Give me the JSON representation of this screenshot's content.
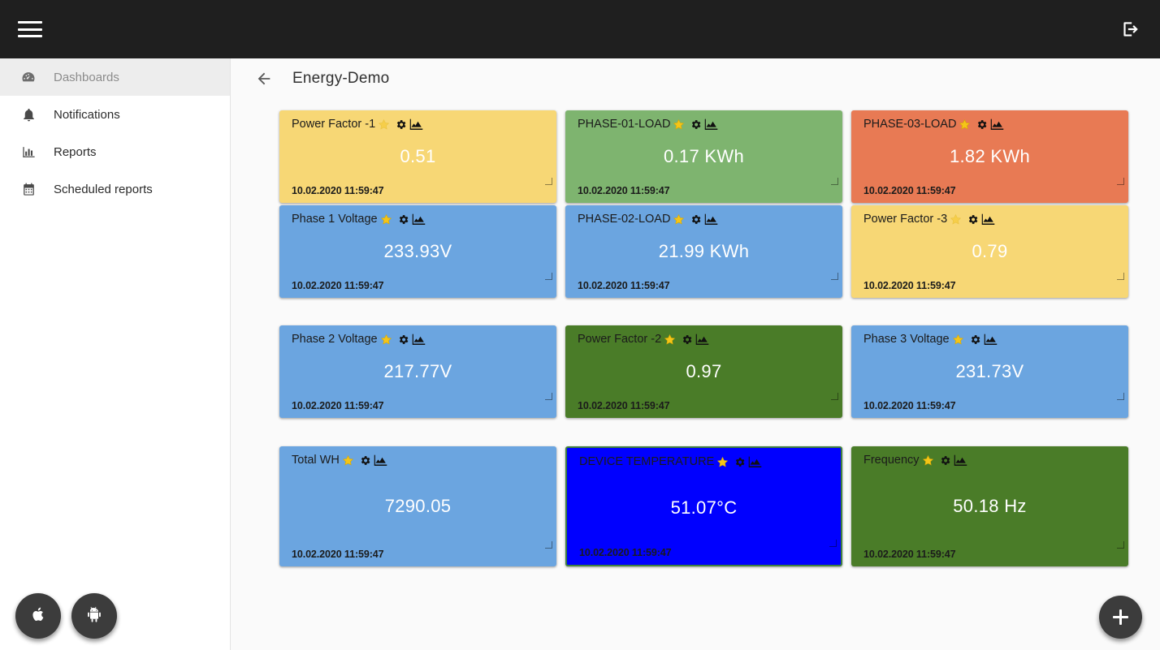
{
  "header": {
    "menu_icon": "hamburger-menu-icon",
    "logout_icon": "logout-icon"
  },
  "sidebar": {
    "items": [
      {
        "label": "Dashboards",
        "icon": "dashboard-gauge-icon",
        "active": true
      },
      {
        "label": "Notifications",
        "icon": "bell-icon",
        "active": false
      },
      {
        "label": "Reports",
        "icon": "bar-chart-icon",
        "active": false
      },
      {
        "label": "Scheduled reports",
        "icon": "calendar-icon",
        "active": false
      }
    ]
  },
  "page": {
    "back_icon": "back-arrow-icon",
    "title": "Energy-Demo"
  },
  "widget_icons": {
    "star": "star-icon",
    "gear": "gear-icon",
    "chart": "area-chart-icon",
    "resize": "resize-handle-icon"
  },
  "colors": {
    "yellow": "#f7d775",
    "light_green": "#7eb46f",
    "orange": "#e87a54",
    "blue": "#6ba5e0",
    "dark_green": "#4a7c28",
    "bright_blue": "#0000ff",
    "selected_border": "#3f7f3f",
    "topbar": "#1f1f1f",
    "fab": "#3c3c3c"
  },
  "cards": [
    {
      "title": "Power Factor -1",
      "value": "0.51",
      "time": "10.02.2020 11:59:47",
      "color": "#f7d775",
      "star_faded": true,
      "height": "short",
      "selected": false
    },
    {
      "title": "PHASE-01-LOAD",
      "value": "0.17 KWh",
      "time": "10.02.2020 11:59:47",
      "color": "#7eb46f",
      "star_faded": false,
      "height": "short",
      "selected": false
    },
    {
      "title": "PHASE-03-LOAD",
      "value": "1.82 KWh",
      "time": "10.02.2020 11:59:47",
      "color": "#e87a54",
      "star_faded": false,
      "height": "short",
      "selected": false
    },
    {
      "title": "Phase 1 Voltage",
      "value": "233.93V",
      "time": "10.02.2020 11:59:47",
      "color": "#6ba5e0",
      "star_faded": false,
      "height": "short",
      "selected": false
    },
    {
      "title": "PHASE-02-LOAD",
      "value": "21.99 KWh",
      "time": "10.02.2020 11:59:47",
      "color": "#6ba5e0",
      "star_faded": false,
      "height": "short",
      "selected": false
    },
    {
      "title": "Power Factor -3",
      "value": "0.79",
      "time": "10.02.2020 11:59:47",
      "color": "#f7d775",
      "star_faded": true,
      "height": "short",
      "selected": false
    },
    {
      "title": "Phase 2 Voltage",
      "value": "217.77V",
      "time": "10.02.2020 11:59:47",
      "color": "#6ba5e0",
      "star_faded": false,
      "height": "short",
      "selected": false
    },
    {
      "title": "Power Factor -2",
      "value": "0.97",
      "time": "10.02.2020 11:59:47",
      "color": "#4a7c28",
      "star_faded": false,
      "height": "short",
      "selected": false
    },
    {
      "title": "Phase 3 Voltage",
      "value": "231.73V",
      "time": "10.02.2020 11:59:47",
      "color": "#6ba5e0",
      "star_faded": false,
      "height": "short",
      "selected": false
    },
    {
      "title": "Total WH",
      "value": "7290.05",
      "time": "10.02.2020 11:59:47",
      "color": "#6ba5e0",
      "star_faded": false,
      "height": "tall",
      "selected": false
    },
    {
      "title": "DEVICE TEMPERATURE",
      "value": "51.07°C",
      "time": "10.02.2020 11:59:47",
      "color": "#0000ff",
      "star_faded": false,
      "height": "tall",
      "selected": true
    },
    {
      "title": "Frequency",
      "value": "50.18 Hz",
      "time": "10.02.2020 11:59:47",
      "color": "#4a7c28",
      "star_faded": false,
      "height": "tall",
      "selected": false
    }
  ],
  "fabs": [
    {
      "name": "apple-fab",
      "icon": "apple-logo-icon"
    },
    {
      "name": "android-fab",
      "icon": "android-robot-icon"
    },
    {
      "name": "add-fab",
      "icon": "plus-icon"
    }
  ]
}
